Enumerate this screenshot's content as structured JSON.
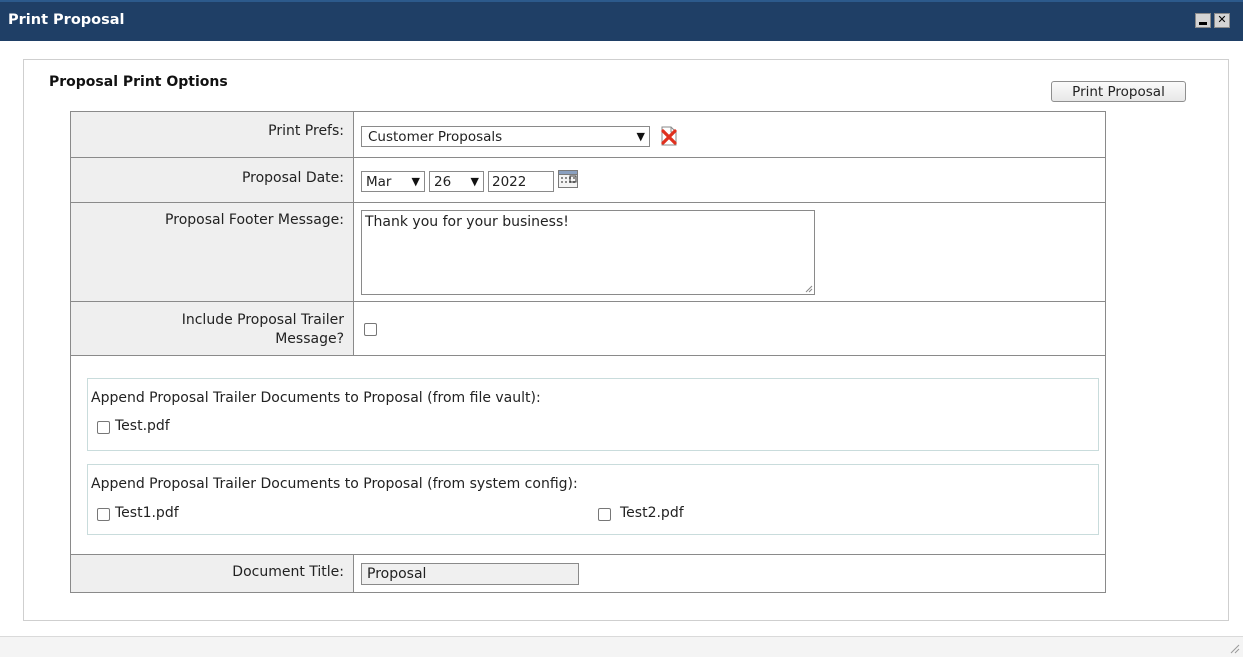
{
  "window": {
    "title": "Print Proposal",
    "close_symbol": "✕",
    "colors": {
      "titlebar": "#1f3f66",
      "label_bg": "#efefef"
    }
  },
  "panel": {
    "title": "Proposal Print Options",
    "print_button": "Print Proposal"
  },
  "form": {
    "print_prefs": {
      "label": "Print Prefs:",
      "value": "Customer Proposals",
      "icon": "delete-icon"
    },
    "proposal_date": {
      "label": "Proposal Date:",
      "month": "Mar",
      "day": "26",
      "year": "2022",
      "icon": "calendar-icon"
    },
    "footer_message": {
      "label": "Proposal Footer Message:",
      "value": "Thank you for your business!"
    },
    "include_trailer": {
      "label_line1": "Include Proposal Trailer",
      "label_line2": "Message?",
      "checked": false
    },
    "file_vault": {
      "heading": "Append Proposal Trailer Documents to Proposal (from file vault):",
      "files": [
        {
          "name": "Test.pdf",
          "checked": false
        }
      ]
    },
    "system_config": {
      "heading": "Append Proposal Trailer Documents to Proposal (from system config):",
      "files": [
        {
          "name": "Test1.pdf",
          "checked": false
        },
        {
          "name": "Test2.pdf",
          "checked": false
        }
      ]
    },
    "document_title": {
      "label": "Document Title:",
      "value": "Proposal"
    }
  }
}
